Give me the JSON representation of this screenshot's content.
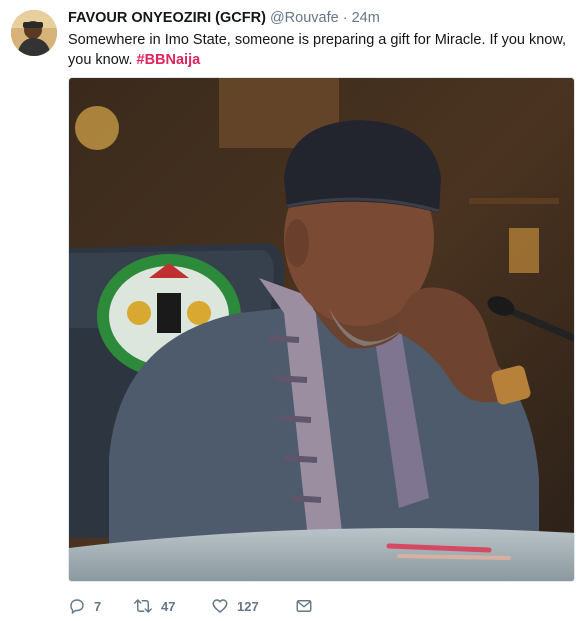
{
  "tweet": {
    "author_name": "FAVOUR ONYEOZIRI (GCFR)",
    "handle": "@Rouvafe",
    "separator": "·",
    "time": "24m",
    "text": "Somewhere in Imo State, someone is preparing a gift for Miracle. If you know, you know. ",
    "hashtag": "#BBNaija",
    "hashtag_color": "#e0245e"
  },
  "actions": {
    "replies": "7",
    "retweets": "47",
    "likes": "127"
  },
  "icons": {
    "reply": "reply-icon",
    "retweet": "retweet-icon",
    "like": "heart-icon",
    "dm": "envelope-icon"
  }
}
